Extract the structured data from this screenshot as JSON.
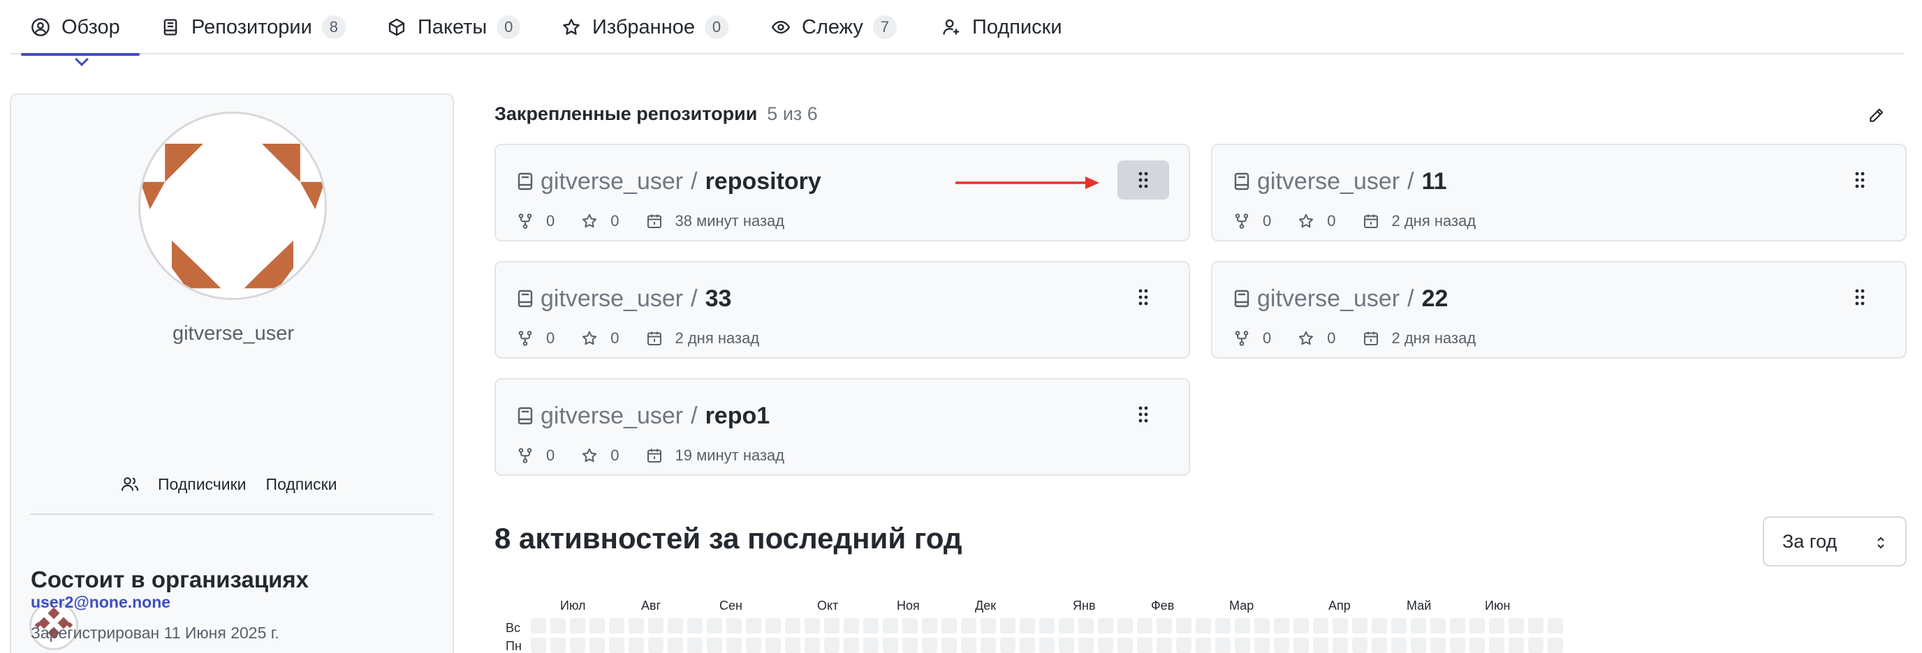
{
  "tabs": [
    {
      "label": "Обзор",
      "icon": "user-circle-icon",
      "count": null,
      "active": true
    },
    {
      "label": "Репозитории",
      "icon": "book-icon",
      "count": "8"
    },
    {
      "label": "Пакеты",
      "icon": "package-icon",
      "count": "0"
    },
    {
      "label": "Избранное",
      "icon": "star-icon",
      "count": "0"
    },
    {
      "label": "Слежу",
      "icon": "eye-icon",
      "count": "7"
    },
    {
      "label": "Подписки",
      "icon": "person-add-icon",
      "count": null
    }
  ],
  "profile": {
    "username": "gitverse_user",
    "followers_label": "Подписчики",
    "following_label": "Подписки",
    "orgs_title": "Состоит в организациях",
    "email": "user2@none.none",
    "registered": "Зарегистрирован 11 Июня 2025 г."
  },
  "pinned": {
    "title": "Закрепленные репозитории",
    "count_text": "5 из 6",
    "repos": [
      {
        "owner": "gitverse_user",
        "name": "repository",
        "forks": "0",
        "stars": "0",
        "updated": "38 минут назад"
      },
      {
        "owner": "gitverse_user",
        "name": "11",
        "forks": "0",
        "stars": "0",
        "updated": "2 дня назад"
      },
      {
        "owner": "gitverse_user",
        "name": "33",
        "forks": "0",
        "stars": "0",
        "updated": "2 дня назад"
      },
      {
        "owner": "gitverse_user",
        "name": "22",
        "forks": "0",
        "stars": "0",
        "updated": "2 дня назад"
      },
      {
        "owner": "gitverse_user",
        "name": "repo1",
        "forks": "0",
        "stars": "0",
        "updated": "19 минут назад"
      }
    ],
    "separator": "/"
  },
  "activity": {
    "title": "8 активностей за последний год",
    "period": "За год",
    "months": [
      "Июл",
      "Авг",
      "Сен",
      "Окт",
      "Ноя",
      "Дек",
      "Янв",
      "Фев",
      "Мар",
      "Апр",
      "Май",
      "Июн"
    ],
    "days": [
      "Вс",
      "Пн"
    ]
  },
  "colors": {
    "accent": "#3d4fbf",
    "avatar_brand": "#c46a3f",
    "org_brand": "#9b5050",
    "annotation_arrow": "#e5322d"
  }
}
